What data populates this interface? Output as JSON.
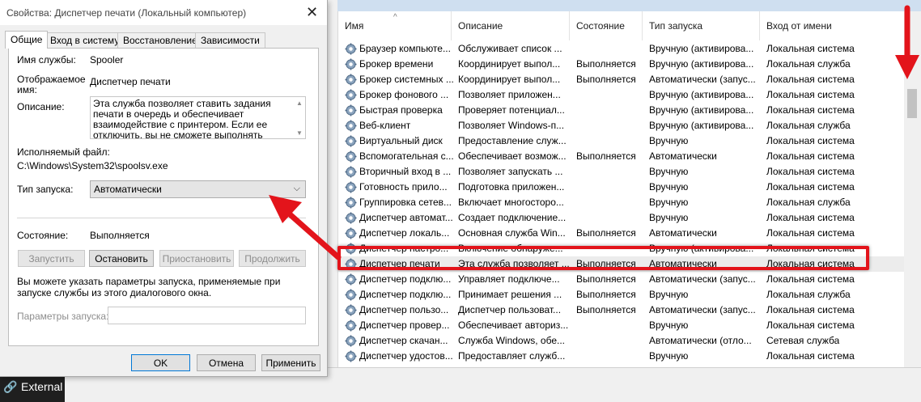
{
  "services_list": {
    "columns": [
      "Имя",
      "Описание",
      "Состояние",
      "Тип запуска",
      "Вход от имени"
    ],
    "rows": [
      [
        "Браузер компьюте...",
        "Обслуживает список ...",
        "",
        "Вручную (активирова...",
        "Локальная система"
      ],
      [
        "Брокер времени",
        "Координирует выпол...",
        "Выполняется",
        "Вручную (активирова...",
        "Локальная служба"
      ],
      [
        "Брокер системных ...",
        "Координирует выпол...",
        "Выполняется",
        "Автоматически (запус...",
        "Локальная система"
      ],
      [
        "Брокер фонового ...",
        "Позволяет приложен...",
        "",
        "Вручную (активирова...",
        "Локальная система"
      ],
      [
        "Быстрая проверка",
        "Проверяет потенциал...",
        "",
        "Вручную (активирова...",
        "Локальная система"
      ],
      [
        "Веб-клиент",
        "Позволяет Windows-п...",
        "",
        "Вручную (активирова...",
        "Локальная служба"
      ],
      [
        "Виртуальный диск",
        "Предоставление служ...",
        "",
        "Вручную",
        "Локальная система"
      ],
      [
        "Вспомогательная с...",
        "Обеспечивает возмож...",
        "Выполняется",
        "Автоматически",
        "Локальная система"
      ],
      [
        "Вторичный вход в ...",
        "Позволяет запускать ...",
        "",
        "Вручную",
        "Локальная система"
      ],
      [
        "Готовность прило...",
        "Подготовка приложен...",
        "",
        "Вручную",
        "Локальная система"
      ],
      [
        "Группировка сетев...",
        "Включает многосторо...",
        "",
        "Вручную",
        "Локальная служба"
      ],
      [
        "Диспетчер автомат...",
        "Создает подключение...",
        "",
        "Вручную",
        "Локальная система"
      ],
      [
        "Диспетчер локаль...",
        "Основная служба Win...",
        "Выполняется",
        "Автоматически",
        "Локальная система"
      ],
      [
        "Диспетчер настро...",
        "Включение обнаруже...",
        "",
        "Вручную (активирова...",
        "Локальная система"
      ],
      [
        "Диспетчер печати",
        "Эта служба позволяет ...",
        "Выполняется",
        "Автоматически",
        "Локальная система"
      ],
      [
        "Диспетчер подклю...",
        "Управляет подключе...",
        "Выполняется",
        "Автоматически (запус...",
        "Локальная система"
      ],
      [
        "Диспетчер подклю...",
        "Принимает решения ...",
        "Выполняется",
        "Вручную",
        "Локальная служба"
      ],
      [
        "Диспетчер пользо...",
        "Диспетчер пользоват...",
        "Выполняется",
        "Автоматически (запус...",
        "Локальная система"
      ],
      [
        "Диспетчер провер...",
        "Обеспечивает авториз...",
        "",
        "Вручную",
        "Локальная система"
      ],
      [
        "Диспетчер скачан...",
        "Служба Windows, обе...",
        "",
        "Автоматически (отло...",
        "Сетевая служба"
      ],
      [
        "Диспетчер удостов...",
        "Предоставляет служб...",
        "",
        "Вручную",
        "Локальная система"
      ]
    ],
    "selected_index": 14
  },
  "taskbar": {
    "label": "External"
  },
  "dialog": {
    "title": "Свойства: Диспетчер печати (Локальный компьютер)",
    "tabs": [
      "Общие",
      "Вход в систему",
      "Восстановление",
      "Зависимости"
    ],
    "active_tab": 0,
    "service_name_label": "Имя службы:",
    "service_name_value": "Spooler",
    "display_name_label": "Отображаемое имя:",
    "display_name_value": "Диспетчер печати",
    "description_label": "Описание:",
    "description_value": "Эта служба позволяет ставить задания печати в очередь и обеспечивает взаимодействие с принтером. Если ее отключить, вы не сможете выполнять печать и видеть свои принтеры.",
    "exe_label": "Исполняемый файл:",
    "exe_value": "C:\\Windows\\System32\\spoolsv.exe",
    "startup_label": "Тип запуска:",
    "startup_value": "Автоматически",
    "status_label": "Состояние:",
    "status_value": "Выполняется",
    "btn_start": "Запустить",
    "btn_stop": "Остановить",
    "btn_pause": "Приостановить",
    "btn_resume": "Продолжить",
    "hint": "Вы можете указать параметры запуска, применяемые при запуске службы из этого диалогового окна.",
    "params_label": "Параметры запуска:",
    "params_value": "",
    "btn_ok": "OK",
    "btn_cancel": "Отмена",
    "btn_apply": "Применить"
  },
  "colors": {
    "annotation_red": "#e3141b",
    "selection": "#ececec"
  }
}
